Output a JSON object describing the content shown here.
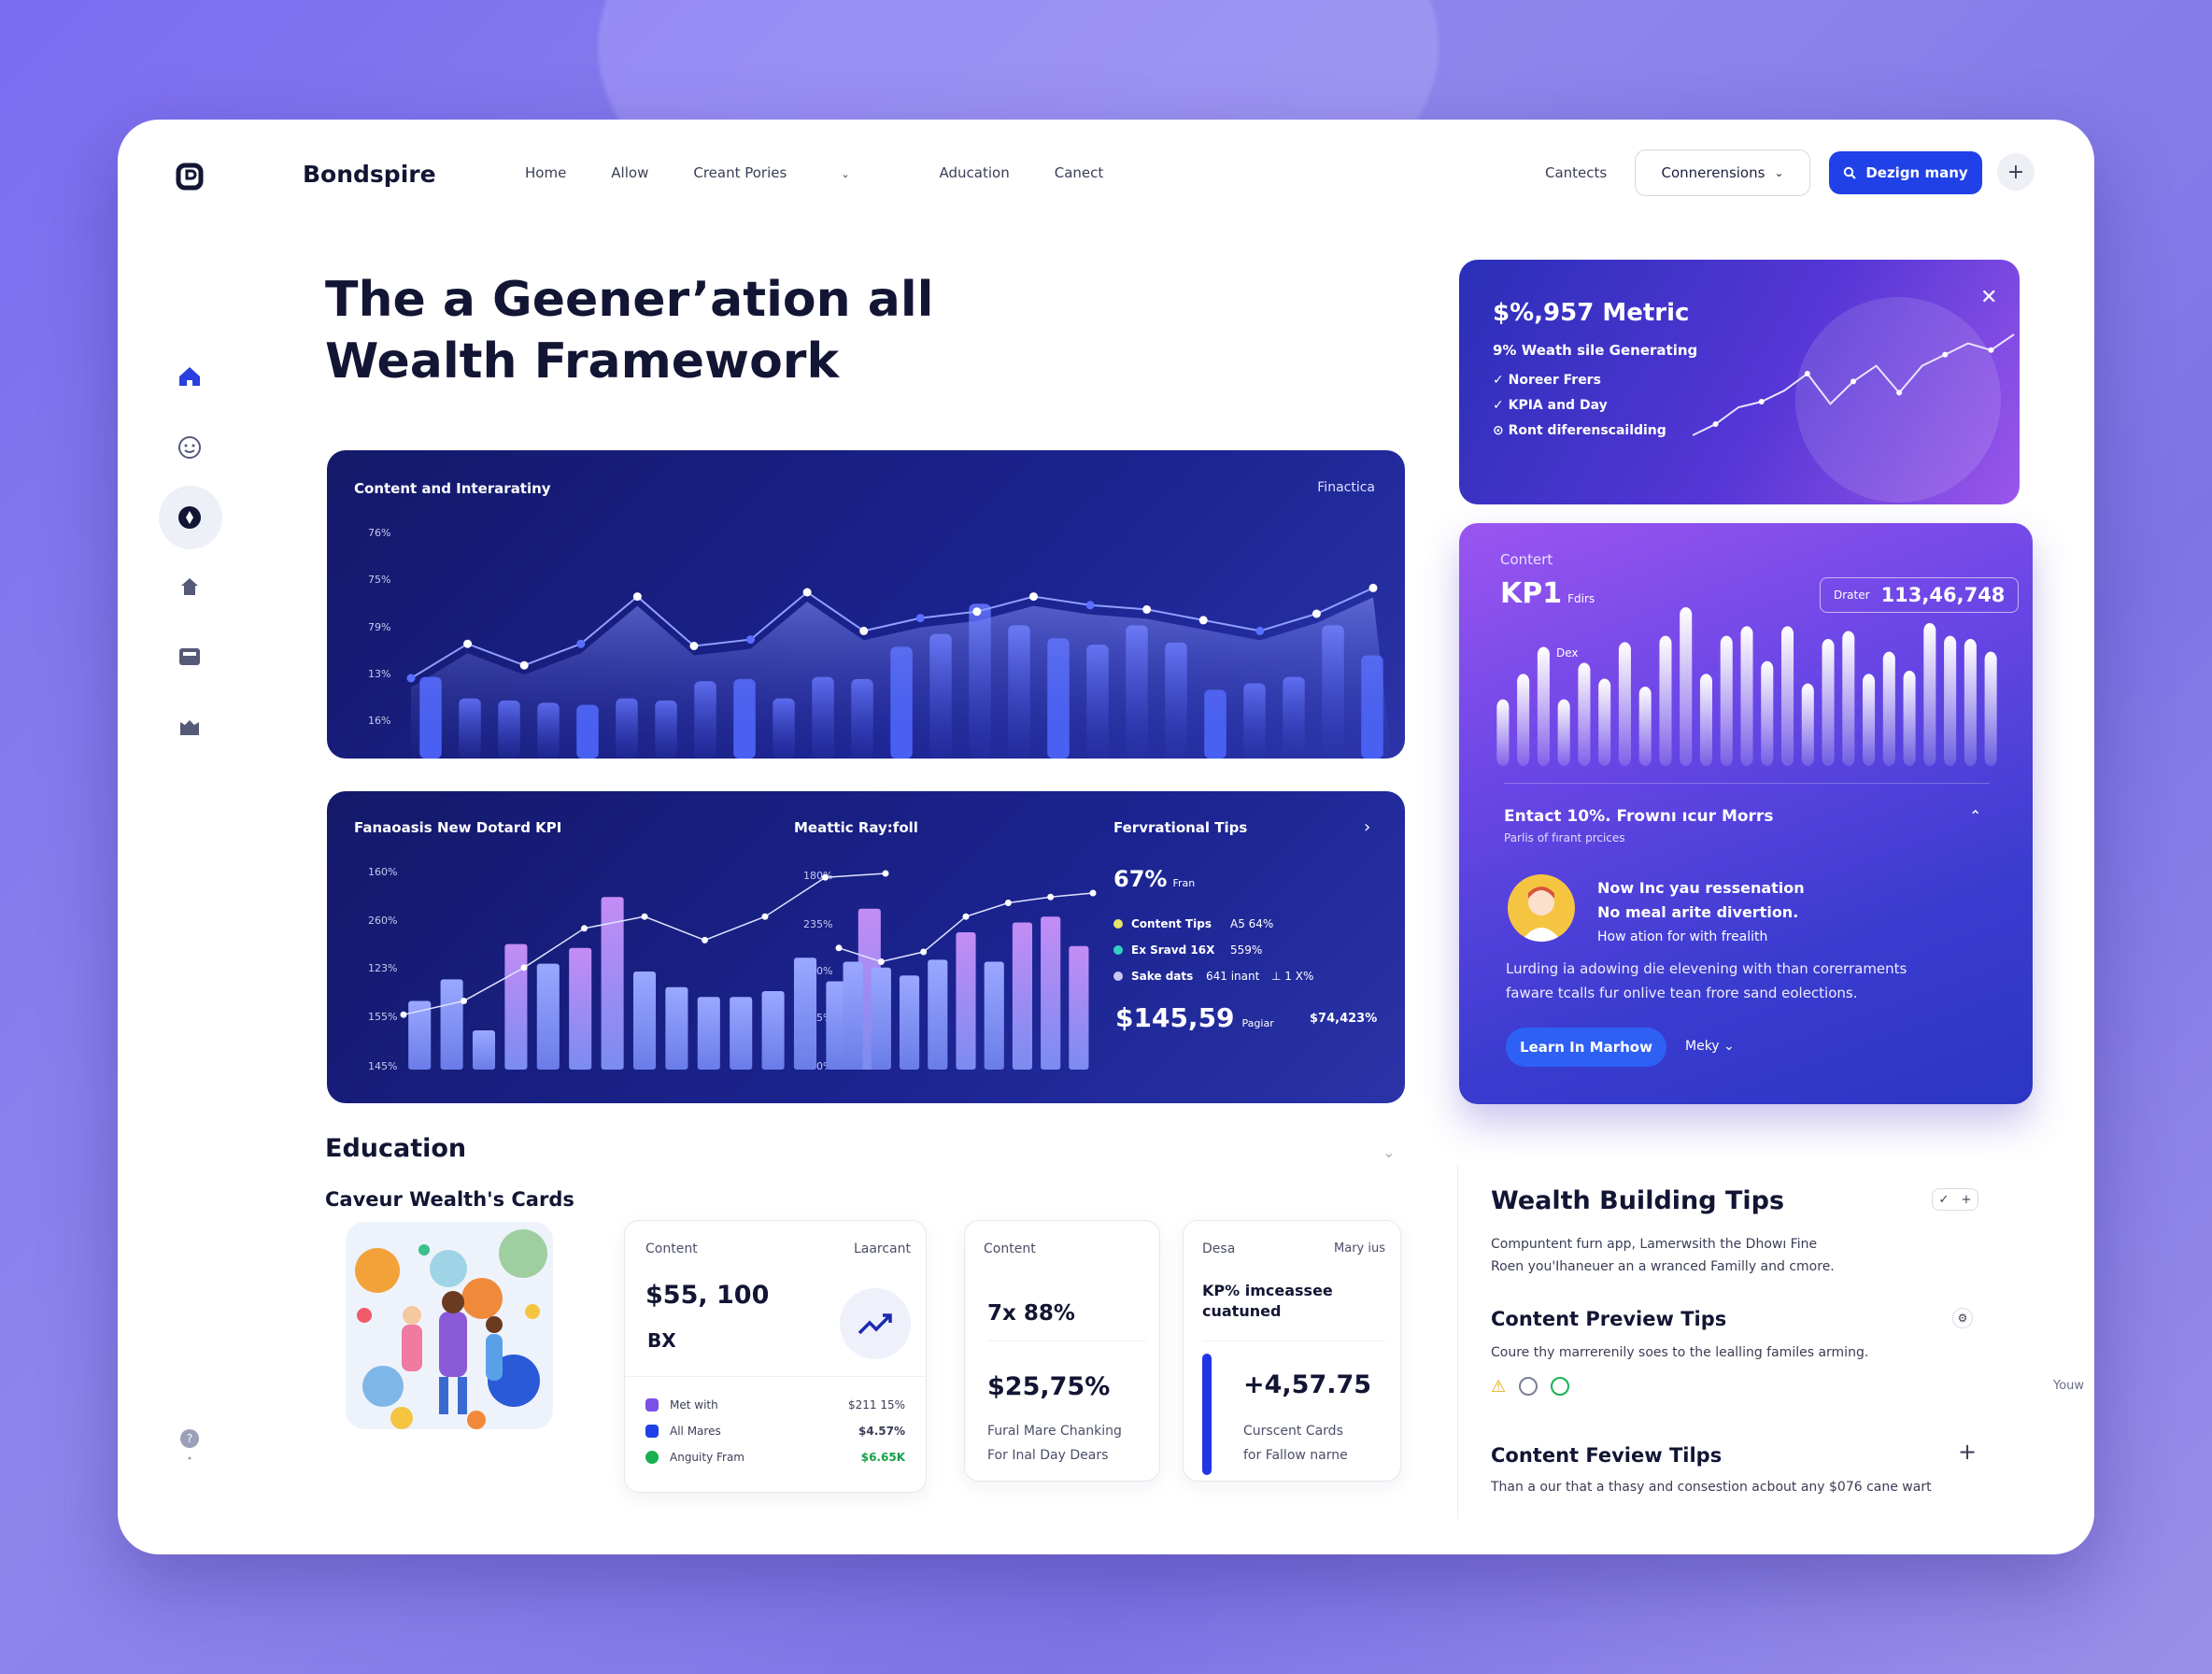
{
  "header": {
    "brand": "Bondspire",
    "nav": [
      "Home",
      "Allow",
      "Creant Pories",
      "Aducation",
      "Canect"
    ],
    "contacts": "Cantects",
    "dropdown_label": "Connerensions",
    "primary_button": "Dezign many"
  },
  "hero": {
    "line1": "The a Geener’ation all",
    "line2": "Wealth Framework"
  },
  "chart_main": {
    "title": "Content and Interaratiny",
    "right_label": "Finactica",
    "yticks": [
      "76%",
      "75%",
      "79%",
      "13%",
      "16%"
    ],
    "chart_data": {
      "type": "bar",
      "bars": [
        0.38,
        0.28,
        0.27,
        0.26,
        0.25,
        0.28,
        0.27,
        0.36,
        0.37,
        0.28,
        0.38,
        0.37,
        0.52,
        0.58,
        0.72,
        0.62,
        0.56,
        0.53,
        0.62,
        0.54,
        0.32,
        0.35,
        0.38,
        0.62,
        0.48
      ],
      "line": [
        0.2,
        0.36,
        0.26,
        0.36,
        0.58,
        0.35,
        0.38,
        0.6,
        0.42,
        0.48,
        0.51,
        0.58,
        0.54,
        0.52,
        0.47,
        0.42,
        0.5,
        0.62
      ],
      "accent": "#4a62f6"
    }
  },
  "kpi_panel": {
    "title": "Fanaoasis New Dotard KPI",
    "yticks": [
      "160%",
      "260%",
      "123%",
      "155%",
      "145%"
    ],
    "chart_data": {
      "type": "bar",
      "values": [
        0.35,
        0.46,
        0.2,
        0.64,
        0.54,
        0.62,
        0.88,
        0.5,
        0.42,
        0.37,
        0.37,
        0.4,
        0.57,
        0.45,
        0.82
      ],
      "line": [
        0.28,
        0.35,
        0.52,
        0.72,
        0.78,
        0.66,
        0.78,
        0.98,
        1.0
      ]
    }
  },
  "metric_panel": {
    "title": "Meattic Ray:foll",
    "yticks": [
      "180%",
      "235%",
      "160%",
      "725%",
      "180%"
    ],
    "chart_data": {
      "type": "bar",
      "values": [
        0.55,
        0.52,
        0.48,
        0.56,
        0.7,
        0.55,
        0.75,
        0.78,
        0.63
      ],
      "line": [
        0.62,
        0.55,
        0.6,
        0.78,
        0.85,
        0.88,
        0.9
      ]
    }
  },
  "tips_panel": {
    "title": "Fervrational Tips",
    "pct": "67%",
    "pct_sub": "Fran",
    "items": [
      {
        "label": "Content Tips",
        "val": "A5 64%",
        "extra": "",
        "color": "#e6e36a"
      },
      {
        "label": "Ex Sravd 16X",
        "val": "559%",
        "extra": "",
        "color": "#33d0c0"
      },
      {
        "label": "Sake dats",
        "val": "641 inant",
        "extra": "⊥ 1 X%",
        "color": "#c7c9f5"
      }
    ],
    "amount": "$145,59",
    "amount_sub": "Pagiar",
    "amount_right": "$74,423%"
  },
  "promo": {
    "title": "$%,957 Metric",
    "sub": "9% Weath sile Generating",
    "checks": [
      "Noreer Frers",
      "KPIA and Day",
      "Ront diferenscailding"
    ],
    "line": [
      0.1,
      0.2,
      0.35,
      0.4,
      0.5,
      0.65,
      0.38,
      0.58,
      0.72,
      0.48,
      0.72,
      0.82,
      0.92,
      0.86,
      1.0
    ]
  },
  "kpi_card": {
    "small_label": "Contert",
    "title": "KP1",
    "title_sub": "Fdirs",
    "badge_label": "Drater",
    "badge_value": "113,46,748",
    "mini_label": "Dex",
    "bars": [
      0.42,
      0.58,
      0.75,
      0.42,
      0.65,
      0.55,
      0.78,
      0.5,
      0.82,
      1.0,
      0.58,
      0.82,
      0.88,
      0.66,
      0.88,
      0.52,
      0.8,
      0.85,
      0.58,
      0.72,
      0.6,
      0.9,
      0.82,
      0.8,
      0.72
    ],
    "row_title": "Entact 10%. Frownı ıcur Morrs",
    "row_sub": "Parlis of fırant prcices",
    "person_line1": "Now Inc yau ressenation",
    "person_line2": "No meal arite divertion.",
    "person_line3": "How ation for with frealith",
    "body": "Lurding ia adowing die elevening with than corerraments\nfaware tcalls fur onlive tean frore sand eolections.",
    "cta": "Learn In Marhow",
    "more": "Meky"
  },
  "education": {
    "title": "Education",
    "sub": "Caveur Wealth's Cards",
    "card1": {
      "label": "Content",
      "label_right": "Laarcant",
      "value": "$55, 100",
      "value2": "BX",
      "rows": [
        {
          "label": "Met with",
          "val": "$211 15%",
          "color": "#7b4fe8"
        },
        {
          "label": "All Mares",
          "val": "$4.57%",
          "color": "#2040e8"
        },
        {
          "label": "Anguity Fram",
          "val": "$6.65K",
          "color": "#18b050"
        }
      ]
    },
    "card2": {
      "label": "Content",
      "value1": "7x 88%",
      "value2": "$25,75%",
      "line1": "Fural Mare Chanking",
      "line2": "For Inal Day Dears"
    },
    "card3": {
      "label": "Desa",
      "label_right": "Mary ius",
      "head1": "KP% imceassee",
      "head2": "cuatuned",
      "value": "+4,57.75",
      "line1": "Curscent Cards",
      "line2": "for Fallow narne"
    }
  },
  "wealth_tips": {
    "title": "Wealth Building Tips",
    "p1a": "Compuntent furn app, Lamerwsith the Dhowı Fine",
    "p1b": "Roen you'Ihaneuer an a wranced Familly and cmore.",
    "h2": "Content Preview Tips",
    "p2": "Coure thy marrerenily soes to the lealling familes arming.",
    "p2_right": "Youw",
    "h3": "Content Feview Tilps",
    "p3": "Than a our that a thasy and consestion acbout any $076 cane wart"
  }
}
